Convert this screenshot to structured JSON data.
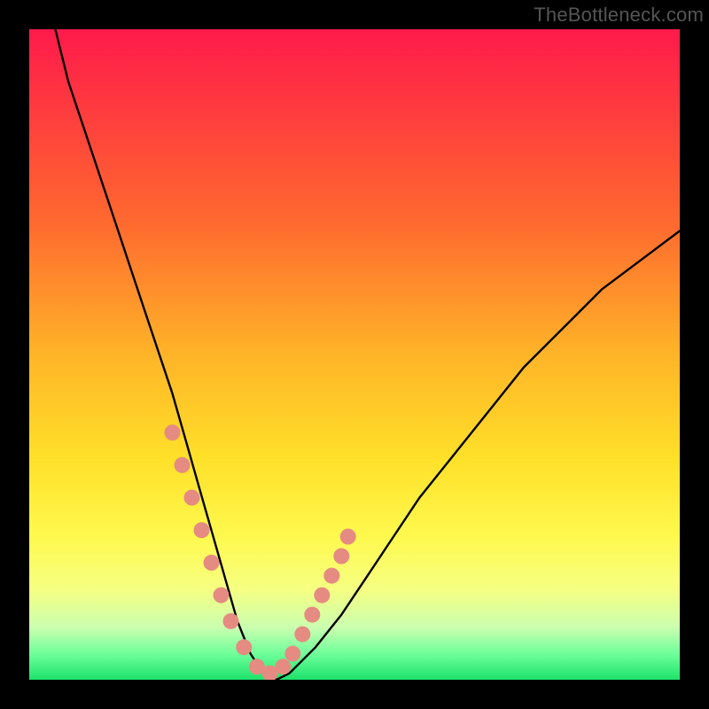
{
  "watermark": "TheBottleneck.com",
  "chart_data": {
    "type": "line",
    "title": "",
    "xlabel": "",
    "ylabel": "",
    "xlim": [
      0,
      100
    ],
    "ylim": [
      0,
      100
    ],
    "grid": false,
    "legend": false,
    "series": [
      {
        "name": "bottleneck-curve",
        "x_pct": [
          4,
          6,
          8,
          10,
          12,
          14,
          16,
          18,
          20,
          22,
          24,
          26,
          28,
          30,
          32,
          34,
          36,
          38,
          40,
          44,
          48,
          52,
          56,
          60,
          64,
          68,
          72,
          76,
          80,
          84,
          88,
          92,
          96,
          100
        ],
        "y_pct": [
          100,
          92,
          86,
          80,
          74,
          68,
          62,
          56,
          50,
          44,
          37,
          30,
          23,
          16,
          9,
          4,
          1,
          0,
          1,
          5,
          10,
          16,
          22,
          28,
          33,
          38,
          43,
          48,
          52,
          56,
          60,
          63,
          66,
          69
        ],
        "note": "Approximate V-shaped bottleneck curve. Values are percentages of plot area; y=0 at bottom, y=100 at top. Minimum near x≈37, rises more slowly on the right."
      }
    ],
    "markers": {
      "name": "highlight-dots",
      "description": "Salmon-colored dots clustered near the valley of the curve on both branches.",
      "x_pct": [
        22,
        23.5,
        25,
        26.5,
        28,
        29.5,
        31,
        33,
        35,
        37,
        39,
        40.5,
        42,
        43.5,
        45,
        46.5,
        48,
        49
      ],
      "y_pct": [
        38,
        33,
        28,
        23,
        18,
        13,
        9,
        5,
        2,
        1,
        2,
        4,
        7,
        10,
        13,
        16,
        19,
        22
      ]
    },
    "colors": {
      "curve": "#000000",
      "markers": "#e58b82",
      "background_gradient": [
        "#ff1a4b",
        "#ff6a2f",
        "#ffe029",
        "#f6ff81",
        "#1de26c"
      ]
    }
  }
}
